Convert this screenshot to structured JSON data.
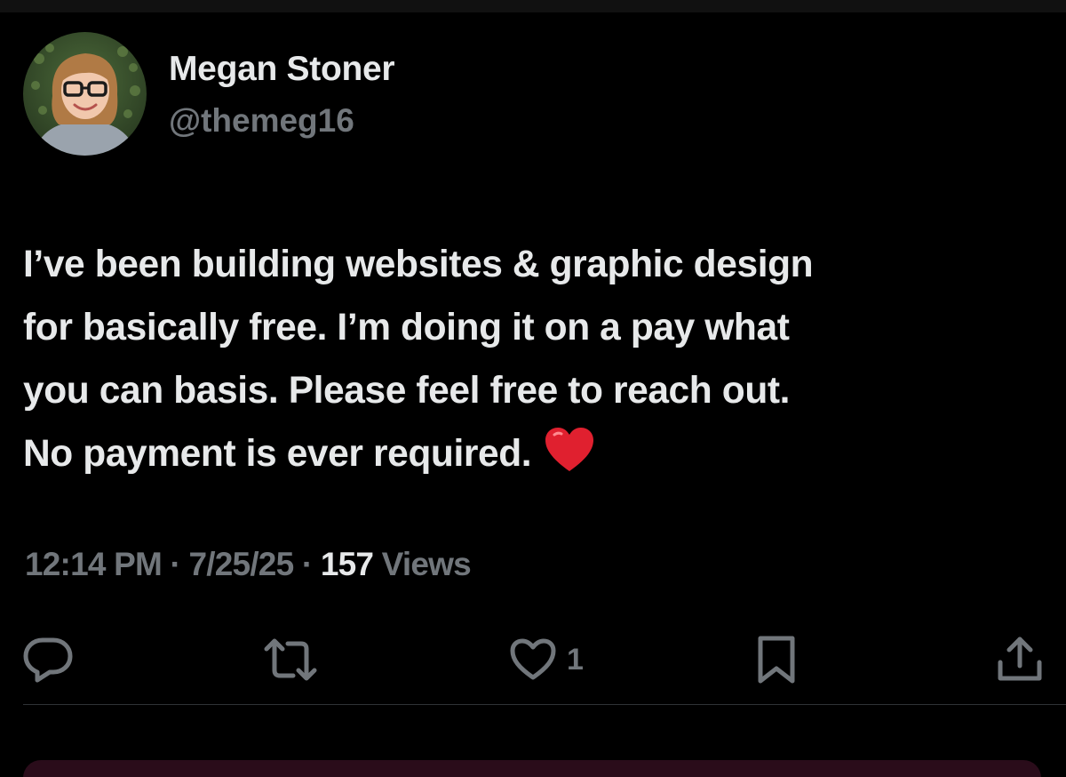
{
  "author": {
    "display_name": "Megan Stoner",
    "handle": "@themeg16",
    "avatar_icon": "profile-photo"
  },
  "tweet": {
    "text_lines": [
      "I’ve been building websites & graphic design",
      "for basically free. I’m doing it on a pay what",
      "you can basis. Please feel free to reach out.",
      "No payment is ever required."
    ],
    "emoji": "red-heart-emoji"
  },
  "meta": {
    "time": "12:14 PM",
    "separator": " · ",
    "date": "7/25/25",
    "views_count": "157",
    "views_label": "Views"
  },
  "actions": {
    "reply_icon": "reply-icon",
    "retweet_icon": "retweet-icon",
    "like_icon": "heart-icon",
    "like_count": "1",
    "bookmark_icon": "bookmark-icon",
    "share_icon": "share-icon"
  },
  "colors": {
    "background": "#000000",
    "primary_text": "#e7e9ea",
    "secondary_text": "#71767b",
    "divider": "#2f3336",
    "heart_emoji": "#e0202f"
  }
}
